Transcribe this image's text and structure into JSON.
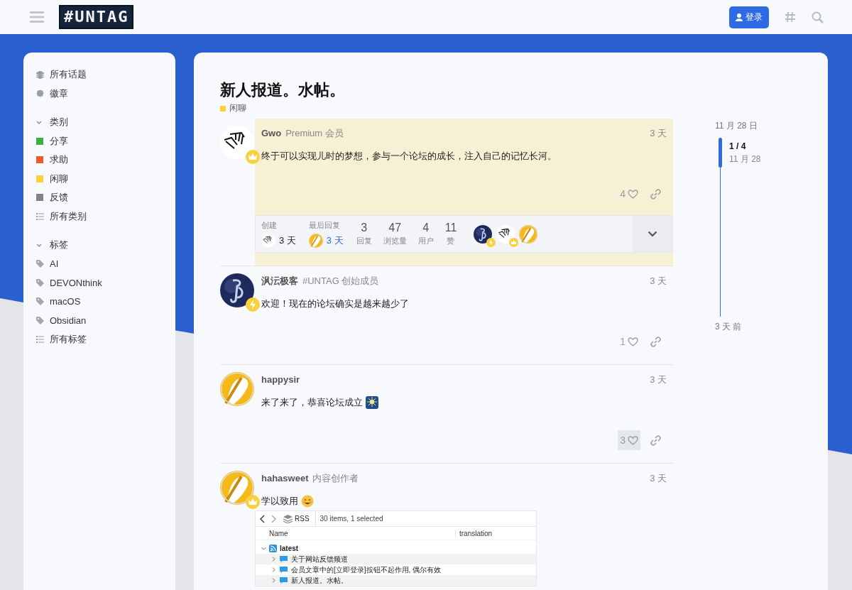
{
  "header": {
    "logo": "#UNTAG",
    "login_button": "登录"
  },
  "sidebar": {
    "top_items": [
      {
        "label": "所有话题"
      },
      {
        "label": "徽章"
      }
    ],
    "sections": [
      {
        "title": "类别",
        "expanded": true,
        "items": [
          {
            "kind": "category",
            "label": "分享",
            "color": "#3cb043"
          },
          {
            "kind": "category",
            "label": "求助",
            "color": "#ef5a28"
          },
          {
            "kind": "category",
            "label": "闲聊",
            "color": "#fcd03b"
          },
          {
            "kind": "category",
            "label": "反馈",
            "color": "#808285"
          },
          {
            "kind": "all",
            "label": "所有类别"
          }
        ]
      },
      {
        "title": "标签",
        "expanded": true,
        "items": [
          {
            "kind": "tag",
            "label": "AI"
          },
          {
            "kind": "tag",
            "label": "DEVONthink"
          },
          {
            "kind": "tag",
            "label": "macOS"
          },
          {
            "kind": "tag",
            "label": "Obsidian"
          },
          {
            "kind": "all",
            "label": "所有标签"
          }
        ]
      }
    ]
  },
  "topic": {
    "title": "新人报道。水帖。",
    "category": {
      "label": "闲聊",
      "color": "#fcd03b"
    }
  },
  "posts": [
    {
      "username": "Gwo",
      "user_title": "Premium 会员",
      "date": "3 天",
      "body": "终于可以实现儿时的梦想，参与一个论坛的成长，注入自己的记忆长河。",
      "likes": "4",
      "highlighted": true,
      "hovered": false,
      "topic_map": {
        "created_label": "创建",
        "created_date": "3 天",
        "last_reply_label": "最后回复",
        "last_reply_date": "3 天",
        "stats": [
          {
            "value": "3",
            "label": "回复"
          },
          {
            "value": "47",
            "label": "浏览量"
          },
          {
            "value": "4",
            "label": "用户"
          },
          {
            "value": "11",
            "label": "赞"
          }
        ]
      }
    },
    {
      "username": "沨沄极客",
      "user_title": "#UNTAG 创始成员",
      "date": "3 天",
      "body": "欢迎！现在的论坛确实是越来越少了",
      "likes": "1",
      "highlighted": false,
      "hovered": false
    },
    {
      "username": "happysir",
      "date": "3 天",
      "body": "来了来了，恭喜论坛成立",
      "likes": "3",
      "highlighted": false,
      "hovered": true
    },
    {
      "username": "hahasweet",
      "user_title": "内容创作者",
      "date": "3 天",
      "body": "学以致用",
      "highlighted": false,
      "embed": {
        "toolbar_title": "RSS",
        "status": "30 items, 1 selected",
        "columns": [
          "Name",
          "translation"
        ],
        "tree": [
          {
            "label": "latest",
            "expanded": true,
            "children": [
              {
                "label": "关于网站反馈频道",
                "expanded": false
              },
              {
                "label": "会员文章中的[立即登录]按钮不起作用, 偶尔有效",
                "expanded": false
              },
              {
                "label": "新人报道。水帖。",
                "expanded": false
              }
            ]
          }
        ]
      }
    }
  ],
  "timeline": {
    "start": "11 月 28 日",
    "position": "1 / 4",
    "position_date": "11 月 28",
    "end": "3 天 前"
  }
}
